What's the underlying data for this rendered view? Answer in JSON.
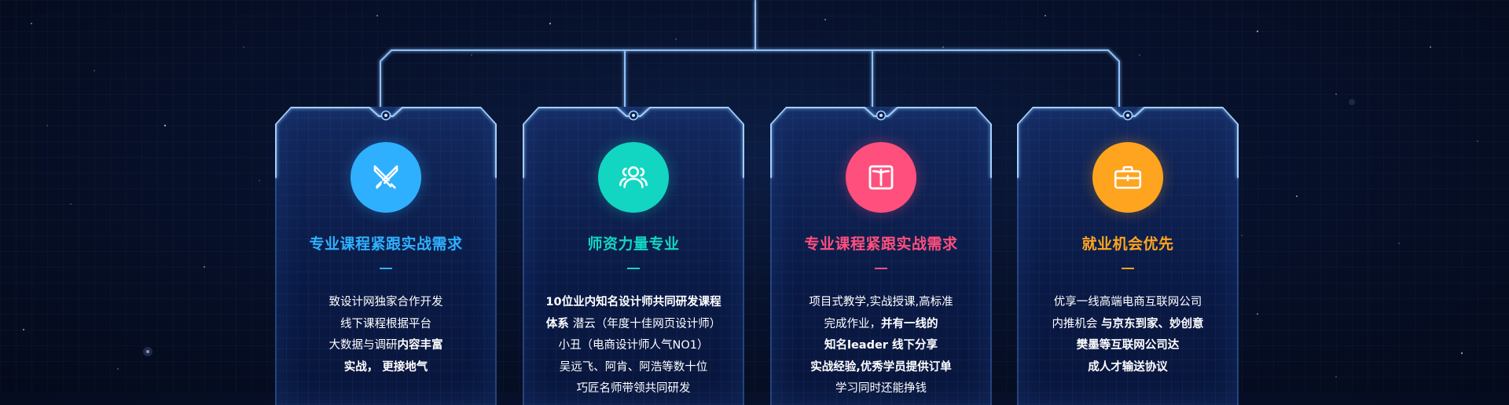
{
  "colors": {
    "background": "#060f28",
    "line": "#7fb8ff",
    "accent": "#2fa9ff"
  },
  "cards": [
    {
      "icon": "swords-icon",
      "color": "#2fb0ff",
      "title": "专业课程紧跟实战需求",
      "lines": [
        [
          {
            "t": "致设计网独家合作开发",
            "b": false
          }
        ],
        [
          {
            "t": "线下课程根据平台",
            "b": false
          }
        ],
        [
          {
            "t": "大数据与调研",
            "b": false
          },
          {
            "t": "内容丰富",
            "b": true
          }
        ],
        [
          {
            "t": "实战， 更接地气",
            "b": true
          }
        ]
      ]
    },
    {
      "icon": "team-icon",
      "color": "#12d6c1",
      "title": "师资力量专业",
      "lines": [
        [
          {
            "t": "10位业内知名设计师共同研发课程",
            "b": true
          }
        ],
        [
          {
            "t": "体系 ",
            "b": true
          },
          {
            "t": "潜云（年度十佳网页设计师）",
            "b": false
          }
        ],
        [
          {
            "t": "小丑（电商设计师人气NO1）",
            "b": false
          }
        ],
        [
          {
            "t": "吴远飞、阿肯、阿浩等数十位",
            "b": false
          }
        ],
        [
          {
            "t": "巧匠名师带领共同研发",
            "b": false
          }
        ]
      ]
    },
    {
      "icon": "book-icon",
      "color": "#ff4f7d",
      "title": "专业课程紧跟实战需求",
      "lines": [
        [
          {
            "t": "项目式教学,实战授课,高标准",
            "b": false
          }
        ],
        [
          {
            "t": "完成作业，",
            "b": false
          },
          {
            "t": "并有一线的",
            "b": true
          }
        ],
        [
          {
            "t": "知名leader 线下分享",
            "b": true
          }
        ],
        [
          {
            "t": "实战经验,优秀学员提供订单",
            "b": true
          }
        ],
        [
          {
            "t": "学习同时还能挣钱",
            "b": false
          }
        ]
      ]
    },
    {
      "icon": "briefcase-icon",
      "color": "#ffa41f",
      "title": "就业机会优先",
      "lines": [
        [
          {
            "t": "优享一线高端电商互联网公司",
            "b": false
          }
        ],
        [
          {
            "t": "内推机会 ",
            "b": false
          },
          {
            "t": "与京东到家、妙创意",
            "b": true
          }
        ],
        [
          {
            "t": "樊墨等互联网公司达",
            "b": true
          }
        ],
        [
          {
            "t": "成人才输送协议",
            "b": true
          }
        ]
      ]
    }
  ]
}
